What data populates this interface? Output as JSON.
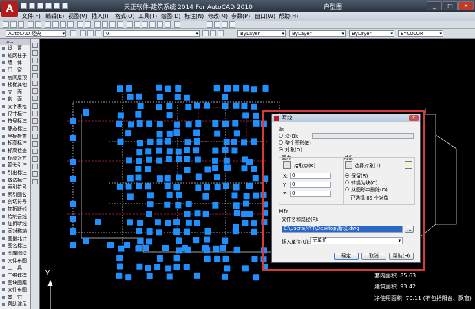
{
  "app": {
    "title": "天正软件-建筑系统 2014  For AutoCAD 2010",
    "tab": "户型图"
  },
  "menu": [
    "文件(F)",
    "编辑(E)",
    "视图(V)",
    "插入(I)",
    "格式(O)",
    "工具(T)",
    "绘图(D)",
    "标注(N)",
    "修改(M)",
    "参数(P)",
    "窗口(W)",
    "帮助(H)"
  ],
  "toolbar": {
    "workspace": "AutoCAD 经典",
    "layer": "0",
    "color": "ByLayer",
    "linetype": "ByLayer",
    "lineweight": "ByLayer",
    "plotstyle": "BYCOLOR"
  },
  "palette": {
    "header": "天...",
    "items": [
      "设　置",
      "轴网柱子",
      "墙　体",
      "门　窗",
      "房间屋顶",
      "楼梯其他",
      "立　面",
      "剖　面",
      "文字表格",
      "尺寸标注",
      "符号标注",
      "静态标注",
      "坐标检查",
      "标高标注",
      "标高检查",
      "标高对齐",
      "箭头引注",
      "引出标注",
      "做法标注",
      "索引符号",
      "索引图名",
      "剖切符号",
      "加折断线",
      "绘制云线",
      "加折断线",
      "画对称轴",
      "画指北针",
      "图名标注",
      "图库图块",
      "文件布图",
      "工　具",
      "三维建模",
      "图块图案",
      "文件布图",
      "其　它",
      "帮助演示"
    ]
  },
  "dialog": {
    "title": "写块",
    "source_label": "源",
    "source_options": [
      "块(B):",
      "整个图形(E)",
      "对象(O)"
    ],
    "source_selected": 2,
    "base_point_label": "基点",
    "pick_point": "拾取点(K)",
    "x_label": "X:",
    "y_label": "Y:",
    "z_label": "Z:",
    "x": "0",
    "y": "0",
    "z": "0",
    "objects_label": "对象",
    "select_objects": "选择对象(T)",
    "object_options": [
      "保留(R)",
      "转换为块(C)",
      "从图形中删除(D)"
    ],
    "object_selected": 0,
    "selected_count": "已选择 85 个对象",
    "target_label": "目标",
    "file_label": "文件名和路径(F):",
    "file_path": "C:\\Users\\NYT\\Desktop\\新块.dwg",
    "units_label": "插入单位(U):",
    "units_value": "无单位",
    "ok": "确定",
    "cancel": "取消",
    "help": "帮助(H)"
  },
  "canvas": {
    "area_text_1": "套内面积: 85.63",
    "area_text_2": "建筑面积: 93.42",
    "area_text_3": "净使用面积: 70.11 (不包括阳台、飘窗)",
    "ucs_y": "Y"
  },
  "colors": {
    "grip": "#1e90ff",
    "highlight": "#d63a3a",
    "canvas": "#000000"
  }
}
